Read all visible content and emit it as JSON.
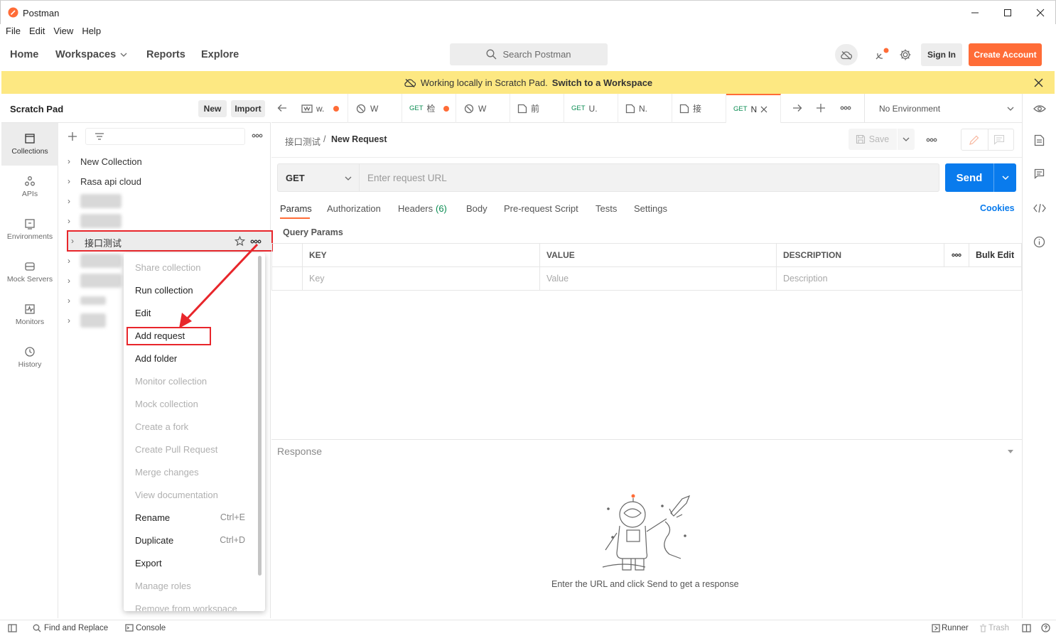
{
  "window": {
    "title": "Postman"
  },
  "menu": [
    "File",
    "Edit",
    "View",
    "Help"
  ],
  "header": {
    "nav": [
      "Home",
      "Workspaces",
      "Reports",
      "Explore"
    ],
    "search_placeholder": "Search Postman",
    "sign_in": "Sign In",
    "create_account": "Create Account",
    "brand_color": "#ff6c37"
  },
  "banner": {
    "text": "Working locally in Scratch Pad.",
    "link": "Switch to a Workspace",
    "color": "#fde882"
  },
  "sidebar": {
    "title": "Scratch Pad",
    "new_label": "New",
    "import_label": "Import",
    "rail": [
      "Collections",
      "APIs",
      "Environments",
      "Mock Servers",
      "Monitors",
      "History"
    ],
    "collections": [
      "New Collection",
      "Rasa api cloud",
      "接口测试"
    ]
  },
  "context_menu": {
    "items": [
      {
        "label": "Share collection",
        "enabled": false
      },
      {
        "label": "Run collection",
        "enabled": true
      },
      {
        "label": "Edit",
        "enabled": true
      },
      {
        "label": "Add request",
        "enabled": true,
        "highlighted": true
      },
      {
        "label": "Add folder",
        "enabled": true
      },
      {
        "label": "Monitor collection",
        "enabled": false
      },
      {
        "label": "Mock collection",
        "enabled": false
      },
      {
        "label": "Create a fork",
        "enabled": false
      },
      {
        "label": "Create Pull Request",
        "enabled": false
      },
      {
        "label": "Merge changes",
        "enabled": false
      },
      {
        "label": "View documentation",
        "enabled": false
      },
      {
        "label": "Rename",
        "enabled": true,
        "shortcut": "Ctrl+E"
      },
      {
        "label": "Duplicate",
        "enabled": true,
        "shortcut": "Ctrl+D"
      },
      {
        "label": "Export",
        "enabled": true
      },
      {
        "label": "Manage roles",
        "enabled": false
      },
      {
        "label": "Remove from workspace",
        "enabled": false
      }
    ]
  },
  "tabs": [
    {
      "method": "",
      "label": "w.",
      "unsaved": true
    },
    {
      "method": "",
      "label": "W",
      "unsaved": false
    },
    {
      "method": "GET",
      "label": "检",
      "unsaved": true
    },
    {
      "method": "",
      "label": "W",
      "unsaved": false
    },
    {
      "method": "",
      "label": "前",
      "unsaved": false
    },
    {
      "method": "GET",
      "label": "U.",
      "unsaved": false
    },
    {
      "method": "",
      "label": "N.",
      "unsaved": false
    },
    {
      "method": "",
      "label": "接",
      "unsaved": false
    },
    {
      "method": "GET",
      "label": "N",
      "unsaved": false,
      "active": true
    }
  ],
  "environment": "No Environment",
  "request": {
    "breadcrumb_parent": "接口测试",
    "breadcrumb_sep": "/",
    "name": "New Request",
    "save_label": "Save",
    "method": "GET",
    "url_placeholder": "Enter request URL",
    "send_label": "Send",
    "send_color": "#097bed",
    "tabs": [
      "Params",
      "Authorization",
      "Headers",
      "Body",
      "Pre-request Script",
      "Tests",
      "Settings"
    ],
    "headers_count": "(6)",
    "cookies_label": "Cookies",
    "query_params_label": "Query Params",
    "columns": [
      "KEY",
      "VALUE",
      "DESCRIPTION"
    ],
    "bulk_edit": "Bulk Edit",
    "placeholders": [
      "Key",
      "Value",
      "Description"
    ]
  },
  "response": {
    "title": "Response",
    "empty_text": "Enter the URL and click Send to get a response"
  },
  "statusbar": {
    "find_replace": "Find and Replace",
    "console": "Console",
    "runner": "Runner",
    "trash": "Trash"
  }
}
